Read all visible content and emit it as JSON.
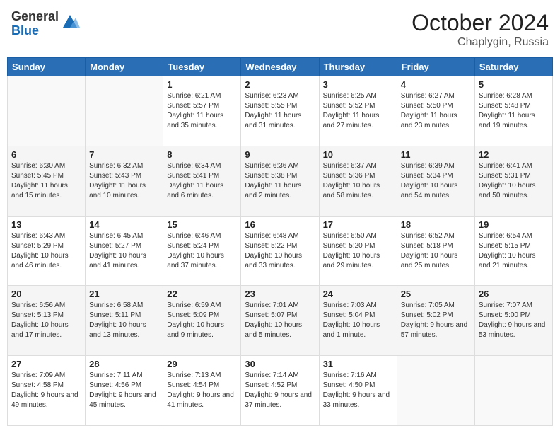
{
  "logo": {
    "general": "General",
    "blue": "Blue"
  },
  "header": {
    "month": "October 2024",
    "location": "Chaplygin, Russia"
  },
  "weekdays": [
    "Sunday",
    "Monday",
    "Tuesday",
    "Wednesday",
    "Thursday",
    "Friday",
    "Saturday"
  ],
  "weeks": [
    [
      {
        "day": "",
        "info": ""
      },
      {
        "day": "",
        "info": ""
      },
      {
        "day": "1",
        "info": "Sunrise: 6:21 AM\nSunset: 5:57 PM\nDaylight: 11 hours and 35 minutes."
      },
      {
        "day": "2",
        "info": "Sunrise: 6:23 AM\nSunset: 5:55 PM\nDaylight: 11 hours and 31 minutes."
      },
      {
        "day": "3",
        "info": "Sunrise: 6:25 AM\nSunset: 5:52 PM\nDaylight: 11 hours and 27 minutes."
      },
      {
        "day": "4",
        "info": "Sunrise: 6:27 AM\nSunset: 5:50 PM\nDaylight: 11 hours and 23 minutes."
      },
      {
        "day": "5",
        "info": "Sunrise: 6:28 AM\nSunset: 5:48 PM\nDaylight: 11 hours and 19 minutes."
      }
    ],
    [
      {
        "day": "6",
        "info": "Sunrise: 6:30 AM\nSunset: 5:45 PM\nDaylight: 11 hours and 15 minutes."
      },
      {
        "day": "7",
        "info": "Sunrise: 6:32 AM\nSunset: 5:43 PM\nDaylight: 11 hours and 10 minutes."
      },
      {
        "day": "8",
        "info": "Sunrise: 6:34 AM\nSunset: 5:41 PM\nDaylight: 11 hours and 6 minutes."
      },
      {
        "day": "9",
        "info": "Sunrise: 6:36 AM\nSunset: 5:38 PM\nDaylight: 11 hours and 2 minutes."
      },
      {
        "day": "10",
        "info": "Sunrise: 6:37 AM\nSunset: 5:36 PM\nDaylight: 10 hours and 58 minutes."
      },
      {
        "day": "11",
        "info": "Sunrise: 6:39 AM\nSunset: 5:34 PM\nDaylight: 10 hours and 54 minutes."
      },
      {
        "day": "12",
        "info": "Sunrise: 6:41 AM\nSunset: 5:31 PM\nDaylight: 10 hours and 50 minutes."
      }
    ],
    [
      {
        "day": "13",
        "info": "Sunrise: 6:43 AM\nSunset: 5:29 PM\nDaylight: 10 hours and 46 minutes."
      },
      {
        "day": "14",
        "info": "Sunrise: 6:45 AM\nSunset: 5:27 PM\nDaylight: 10 hours and 41 minutes."
      },
      {
        "day": "15",
        "info": "Sunrise: 6:46 AM\nSunset: 5:24 PM\nDaylight: 10 hours and 37 minutes."
      },
      {
        "day": "16",
        "info": "Sunrise: 6:48 AM\nSunset: 5:22 PM\nDaylight: 10 hours and 33 minutes."
      },
      {
        "day": "17",
        "info": "Sunrise: 6:50 AM\nSunset: 5:20 PM\nDaylight: 10 hours and 29 minutes."
      },
      {
        "day": "18",
        "info": "Sunrise: 6:52 AM\nSunset: 5:18 PM\nDaylight: 10 hours and 25 minutes."
      },
      {
        "day": "19",
        "info": "Sunrise: 6:54 AM\nSunset: 5:15 PM\nDaylight: 10 hours and 21 minutes."
      }
    ],
    [
      {
        "day": "20",
        "info": "Sunrise: 6:56 AM\nSunset: 5:13 PM\nDaylight: 10 hours and 17 minutes."
      },
      {
        "day": "21",
        "info": "Sunrise: 6:58 AM\nSunset: 5:11 PM\nDaylight: 10 hours and 13 minutes."
      },
      {
        "day": "22",
        "info": "Sunrise: 6:59 AM\nSunset: 5:09 PM\nDaylight: 10 hours and 9 minutes."
      },
      {
        "day": "23",
        "info": "Sunrise: 7:01 AM\nSunset: 5:07 PM\nDaylight: 10 hours and 5 minutes."
      },
      {
        "day": "24",
        "info": "Sunrise: 7:03 AM\nSunset: 5:04 PM\nDaylight: 10 hours and 1 minute."
      },
      {
        "day": "25",
        "info": "Sunrise: 7:05 AM\nSunset: 5:02 PM\nDaylight: 9 hours and 57 minutes."
      },
      {
        "day": "26",
        "info": "Sunrise: 7:07 AM\nSunset: 5:00 PM\nDaylight: 9 hours and 53 minutes."
      }
    ],
    [
      {
        "day": "27",
        "info": "Sunrise: 7:09 AM\nSunset: 4:58 PM\nDaylight: 9 hours and 49 minutes."
      },
      {
        "day": "28",
        "info": "Sunrise: 7:11 AM\nSunset: 4:56 PM\nDaylight: 9 hours and 45 minutes."
      },
      {
        "day": "29",
        "info": "Sunrise: 7:13 AM\nSunset: 4:54 PM\nDaylight: 9 hours and 41 minutes."
      },
      {
        "day": "30",
        "info": "Sunrise: 7:14 AM\nSunset: 4:52 PM\nDaylight: 9 hours and 37 minutes."
      },
      {
        "day": "31",
        "info": "Sunrise: 7:16 AM\nSunset: 4:50 PM\nDaylight: 9 hours and 33 minutes."
      },
      {
        "day": "",
        "info": ""
      },
      {
        "day": "",
        "info": ""
      }
    ]
  ]
}
